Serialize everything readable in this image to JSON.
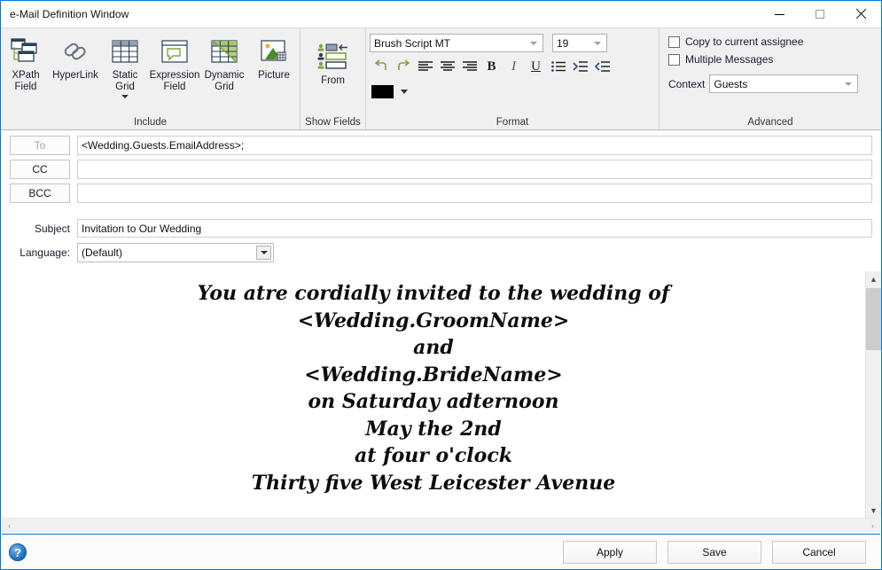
{
  "window": {
    "title": "e-Mail Definition Window",
    "controls": {
      "minimize": "minimize-button",
      "maximize": "maximize-button",
      "close": "close-button"
    },
    "accent_color": "#0078d7",
    "chrome_color": "#f0f0f0"
  },
  "ribbon": {
    "groups": [
      {
        "label": "Include",
        "buttons": [
          {
            "label": "XPath\nField",
            "icon": "xpath-field-icon"
          },
          {
            "label": "HyperLink",
            "icon": "hyperlink-icon"
          },
          {
            "label": "Static\nGrid",
            "icon": "static-grid-icon",
            "has_menu": true
          },
          {
            "label": "Expression\nField",
            "icon": "expression-field-icon"
          },
          {
            "label": "Dynamic\nGrid",
            "icon": "dynamic-grid-icon"
          },
          {
            "label": "Picture",
            "icon": "picture-icon"
          }
        ]
      },
      {
        "label": "Show Fields",
        "buttons": [
          {
            "label": "From",
            "icon": "from-field-icon"
          }
        ]
      },
      {
        "label": "Format",
        "font_family_value": "Brush Script MT",
        "font_size_value": "19",
        "tools": [
          {
            "name": "undo-button",
            "glyph": "undo"
          },
          {
            "name": "redo-button",
            "glyph": "redo"
          },
          {
            "name": "align-left-button",
            "glyph": "align-left"
          },
          {
            "name": "align-center-button",
            "glyph": "align-center"
          },
          {
            "name": "align-right-button",
            "glyph": "align-right"
          },
          {
            "name": "bold-button",
            "glyph": "B"
          },
          {
            "name": "italic-button",
            "glyph": "I"
          },
          {
            "name": "underline-button",
            "glyph": "U"
          },
          {
            "name": "bullet-list-button",
            "glyph": "bullets"
          },
          {
            "name": "increase-indent-button",
            "glyph": "indent-increase"
          },
          {
            "name": "decrease-indent-button",
            "glyph": "indent-decrease"
          }
        ],
        "text_color": "#000000"
      },
      {
        "label": "Advanced",
        "checkboxes": [
          {
            "label": "Copy to current assignee",
            "checked": false
          },
          {
            "label": "Multiple Messages",
            "checked": false
          }
        ],
        "context_label": "Context",
        "context_value": "Guests"
      }
    ]
  },
  "fields": {
    "to": {
      "button_label": "To",
      "value": "<Wedding.Guests.EmailAddress>;",
      "disabled": true
    },
    "cc": {
      "button_label": "CC",
      "value": ""
    },
    "bcc": {
      "button_label": "BCC",
      "value": ""
    },
    "subject": {
      "label": "Subject",
      "value": "Invitation to Our Wedding"
    },
    "language": {
      "label": "Language:",
      "value": "(Default)"
    }
  },
  "editor": {
    "lines": [
      "You atre cordially invited to the wedding of",
      "<Wedding.GroomName>",
      "and",
      "<Wedding.BrideName>",
      "on Saturday adternoon",
      "May the 2nd",
      "at four o'clock",
      "Thirty five West Leicester Avenue"
    ]
  },
  "scrollbars": {
    "vertical": {
      "up": "▲",
      "down": "▼"
    },
    "horizontal": {
      "left": "‹",
      "right": "›"
    }
  },
  "footer": {
    "help": "?",
    "buttons": [
      {
        "label": "Apply",
        "name": "apply-button"
      },
      {
        "label": "Save",
        "name": "save-button"
      },
      {
        "label": "Cancel",
        "name": "cancel-button"
      }
    ]
  }
}
